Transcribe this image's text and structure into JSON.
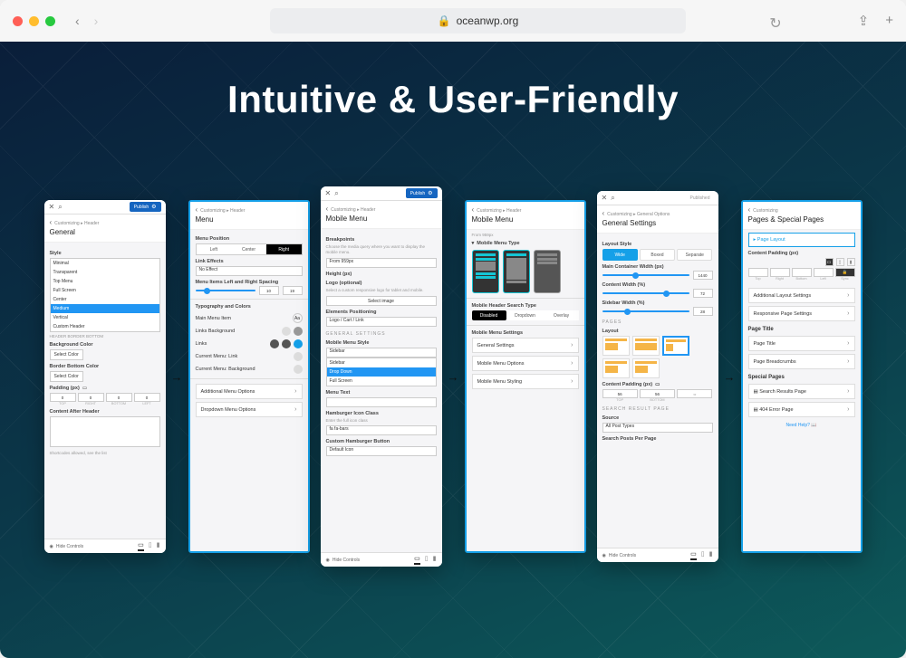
{
  "browser": {
    "url_host": "oceanwp.org"
  },
  "headline": "Intuitive & User-Friendly",
  "publish_label": "Publish",
  "published_label": "Published",
  "hide_controls": "Hide Controls",
  "panel1a": {
    "crumb": "Customizing ▸ Header",
    "title": "General",
    "style_label": "Style",
    "style_options": [
      "Minimal",
      "Transparent",
      "Top Menu",
      "Full Screen",
      "Center",
      "Medium",
      "Vertical",
      "Custom Header"
    ],
    "style_selected": "Medium",
    "header_border_bottom": "HEADER BORDER BOTTOM",
    "bg_color": "Background Color",
    "select_color": "Select Color",
    "border_bottom_color": "Border Bottom Color",
    "padding": "Padding (px)",
    "padding_vals": [
      "0",
      "0",
      "0",
      "0"
    ],
    "padding_lbls": [
      "TOP",
      "RIGHT",
      "BOTTOM",
      "LEFT"
    ],
    "after_header": "Content After Header",
    "shortcodes": "Shortcodes allowed, see the list"
  },
  "panel1b": {
    "crumb": "Customizing ▸ Header",
    "title": "Menu",
    "menu_position": "Menu Position",
    "pos_opts": [
      "Left",
      "Center",
      "Right"
    ],
    "pos_active": "Right",
    "link_effects": "Link Effects",
    "link_effects_val": "No Effect",
    "spacing": "Menu Items Left and Right Spacing",
    "spacing_vals": [
      "10",
      "19"
    ],
    "typo": "Typography and Colors",
    "main_item": "Main Menu Item",
    "links_bg": "Links Background",
    "links": "Links",
    "cur_link": "Current Menu: Link",
    "cur_bg": "Current Menu: Background",
    "additional": "Additional Menu Options",
    "dropdown": "Dropdown Menu Options"
  },
  "panel2a": {
    "crumb": "Customizing ▸ Header",
    "title": "Mobile Menu",
    "breakpoints": "Breakpoints",
    "breakpoints_sub": "Choose the media query where you want to display the mobile menu.",
    "breakpoints_val": "From 959px",
    "height": "Height (px)",
    "logo": "Logo (optional)",
    "logo_sub": "Select a custom responsive logo for tablet and mobile.",
    "select_image": "Select image",
    "elements_pos": "Elements Positioning",
    "elements_pos_val": "Logo / Cart / Link",
    "general": "GENERAL SETTINGS",
    "mm_style": "Mobile Menu Style",
    "mm_style_val": "Sidebar",
    "mm_opts": [
      "Sidebar",
      "Drop Down",
      "Full Screen"
    ],
    "mm_sel": "Drop Down",
    "menu_text": "Menu Text",
    "hamburger_class": "Hamburger Icon Class",
    "hamburger_sub": "Enter the full icon class",
    "hamburger_val": "fa fa-bars",
    "custom_btn": "Custom Hamburger Button",
    "custom_btn_val": "Default Icon"
  },
  "panel2b": {
    "crumb": "Customizing ▸ Header",
    "title": "Mobile Menu",
    "mm_type": "Mobile Menu Type",
    "search_type": "Mobile Header Search Type",
    "search_opts": [
      "Disabled",
      "Dropdown",
      "Overlay"
    ],
    "search_active": "Disabled",
    "mm_settings": "Mobile Menu Settings",
    "rows": [
      "General Settings",
      "Mobile Menu Options",
      "Mobile Menu Styling"
    ]
  },
  "panel3a": {
    "crumb": "Customizing ▸ General Options",
    "title": "General Settings",
    "layout_style": "Layout Style",
    "layout_opts": [
      "Wide",
      "Boxed",
      "Separate"
    ],
    "layout_active": "Wide",
    "main_width": "Main Container Width (px)",
    "main_width_val": "1440",
    "content_width": "Content Width (%)",
    "content_width_val": "72",
    "sidebar_width": "Sidebar Width (%)",
    "sidebar_width_val": "28",
    "pages": "PAGES",
    "layout": "Layout",
    "content_padding": "Content Padding (px)",
    "cp_vals": [
      "56",
      "56"
    ],
    "cp_lbls": [
      "TOP",
      "BOTTOM"
    ],
    "srp": "SEARCH RESULT PAGE",
    "source": "Source",
    "source_val": "All Post Types",
    "spp": "Search Posts Per Page"
  },
  "panel3b": {
    "crumb": "Customizing",
    "title": "Pages & Special Pages",
    "page_layout": "Page Layout",
    "content_padding": "Content Padding (px)",
    "cp_lbls": [
      "Top",
      "Right",
      "Bottom",
      "Left",
      "Sync"
    ],
    "add_layout": "Additional Layout Settings",
    "resp_settings": "Responsive Page Settings",
    "page_title_sec": "Page Title",
    "page_title": "Page Title",
    "breadcrumbs": "Page Breadcrumbs",
    "special": "Special Pages",
    "search_results": "Search Results Page",
    "error_page": "404 Error Page",
    "need_help": "Need Help?"
  }
}
